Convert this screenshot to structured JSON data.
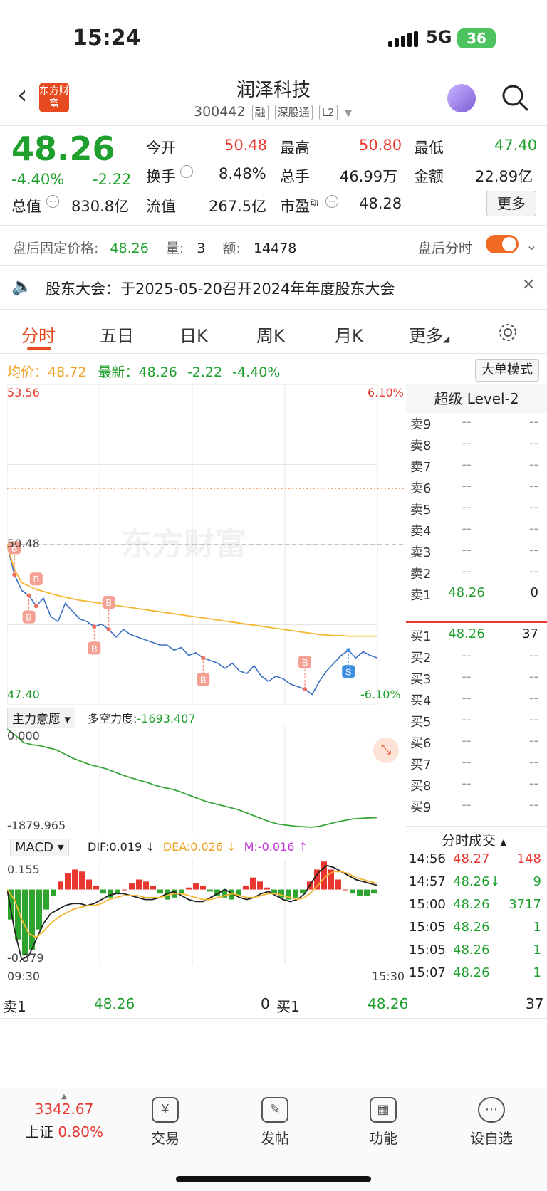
{
  "status_bar": {
    "time": "15:24",
    "network": "5G",
    "battery": "36"
  },
  "header": {
    "logo_text": "东方财富",
    "stock_name": "润泽科技",
    "stock_code": "300442",
    "tags": [
      "融",
      "深股通",
      "L2"
    ]
  },
  "quote": {
    "price": "48.26",
    "change_pct": "-4.40%",
    "change": "-2.22",
    "open_label": "今开",
    "open": "50.48",
    "high_label": "最高",
    "high": "50.80",
    "low_label": "最低",
    "low": "47.40",
    "turnover_label": "换手",
    "turnover": "8.48%",
    "volume_label": "总手",
    "volume": "46.99万",
    "amount_label": "金额",
    "amount": "22.89亿",
    "mktcap_label": "总值",
    "mktcap": "830.8亿",
    "float_label": "流值",
    "float": "267.5亿",
    "pe_label": "市盈",
    "pe_sup": "动",
    "pe": "48.28",
    "more_button": "更多"
  },
  "after_hours": {
    "price_label": "盘后固定价格:",
    "price": "48.26",
    "qty_label": "量:",
    "qty": "3",
    "amt_label": "额:",
    "amt": "14478",
    "toggle_label": "盘后分时"
  },
  "notice": {
    "text": "股东大会：于2025-05-20召开2024年年度股东大会"
  },
  "tabs": [
    "分时",
    "五日",
    "日K",
    "周K",
    "月K",
    "更多"
  ],
  "chart_info": {
    "avg_label": "均价：",
    "avg": "48.72",
    "latest_label": "最新：",
    "latest": "48.26",
    "latest_chg": "-2.22",
    "latest_pct": "-4.40%",
    "big_order_button": "大单模式"
  },
  "chart_data": {
    "type": "line",
    "title": "",
    "y_top_label": "53.56",
    "y_bottom_label": "47.40",
    "pct_top_label": "6.10%",
    "pct_bottom_label": "-6.10%",
    "prev_close_label": "50.48",
    "ylim": [
      47.4,
      53.56
    ],
    "prev_close": 50.48,
    "high_line": 51.56,
    "x_start_label": "09:30",
    "x_end_label": "15:30",
    "watermark": "东方财富",
    "series": [
      {
        "values": [
          50.48,
          49.9,
          49.6,
          49.5,
          49.3,
          49.45,
          49.1,
          49.0,
          49.35,
          49.2,
          49.05,
          49.0,
          48.9,
          48.95,
          48.85,
          48.7,
          48.85,
          48.75,
          48.7,
          48.65,
          48.6,
          48.55,
          48.55,
          48.45,
          48.5,
          48.35,
          48.4,
          48.3,
          48.25,
          48.2,
          48.1,
          48.2,
          48.05,
          48.0,
          48.15,
          47.95,
          47.85,
          47.95,
          47.9,
          47.8,
          47.75,
          47.7,
          47.6,
          47.85,
          48.05,
          48.2,
          48.35,
          48.45,
          48.3,
          48.42,
          48.35,
          48.3
        ]
      },
      {
        "values": [
          50.48,
          50.0,
          49.75,
          49.68,
          49.62,
          49.58,
          49.54,
          49.5,
          49.47,
          49.44,
          49.41,
          49.39,
          49.37,
          49.35,
          49.33,
          49.31,
          49.29,
          49.27,
          49.25,
          49.23,
          49.21,
          49.19,
          49.17,
          49.15,
          49.13,
          49.11,
          49.09,
          49.07,
          49.05,
          49.03,
          49.01,
          48.99,
          48.97,
          48.95,
          48.93,
          48.91,
          48.89,
          48.87,
          48.85,
          48.83,
          48.81,
          48.79,
          48.77,
          48.75,
          48.74,
          48.73,
          48.73,
          48.72,
          48.72,
          48.72,
          48.72,
          48.72
        ]
      }
    ],
    "markers": [
      "B",
      "B",
      "B",
      "B",
      "B",
      "B",
      "B",
      "S"
    ]
  },
  "force_panel": {
    "dropdown": "主力意愿",
    "label": "多空力度:",
    "value": "-1693.407",
    "top": "0.000",
    "bottom": "-1879.965",
    "values": [
      0,
      -120,
      -260,
      -300,
      -320,
      -360,
      -400,
      -480,
      -560,
      -620,
      -680,
      -720,
      -760,
      -820,
      -880,
      -930,
      -980,
      -1020,
      -1080,
      -1120,
      -1150,
      -1200,
      -1260,
      -1320,
      -1380,
      -1420,
      -1460,
      -1500,
      -1540,
      -1600,
      -1660,
      -1720,
      -1780,
      -1820,
      -1840,
      -1860,
      -1870,
      -1879,
      -1860,
      -1820,
      -1780,
      -1750,
      -1720,
      -1710,
      -1700,
      -1693
    ]
  },
  "macd_panel": {
    "dropdown": "MACD",
    "dif": "DIF:0.019",
    "dea": "DEA:0.026",
    "m": "M:-0.016",
    "top": "0.155",
    "bottom": "-0.379",
    "bars": [
      -0.15,
      -0.25,
      -0.33,
      -0.3,
      -0.2,
      -0.1,
      -0.03,
      0.04,
      0.08,
      0.1,
      0.09,
      0.05,
      0.02,
      -0.02,
      -0.04,
      -0.02,
      0.0,
      0.03,
      0.05,
      0.04,
      0.02,
      -0.02,
      -0.05,
      -0.04,
      -0.02,
      0.01,
      0.03,
      0.02,
      -0.01,
      -0.03,
      -0.04,
      -0.05,
      -0.03,
      0.02,
      0.06,
      0.04,
      0.01,
      -0.02,
      -0.04,
      -0.05,
      -0.04,
      -0.02,
      0.04,
      0.1,
      0.14,
      0.1,
      0.05,
      0.0,
      -0.02,
      -0.03,
      -0.03,
      -0.02
    ],
    "dif_line": [
      0,
      -0.2,
      -0.35,
      -0.33,
      -0.25,
      -0.17,
      -0.12,
      -0.1,
      -0.08,
      -0.07,
      -0.07,
      -0.08,
      -0.07,
      -0.05,
      -0.03,
      -0.02,
      -0.02,
      -0.03,
      -0.04,
      -0.05,
      -0.05,
      -0.04,
      -0.02,
      -0.01,
      -0.03,
      -0.05,
      -0.06,
      -0.06,
      -0.04,
      -0.02,
      0.0,
      -0.02,
      -0.04,
      -0.05,
      -0.04,
      -0.02,
      -0.01,
      -0.03,
      -0.05,
      -0.06,
      -0.05,
      -0.02,
      0.04,
      0.09,
      0.12,
      0.11,
      0.09,
      0.07,
      0.05,
      0.04,
      0.03,
      0.02
    ],
    "dea_line": [
      0,
      -0.05,
      -0.15,
      -0.22,
      -0.24,
      -0.21,
      -0.17,
      -0.14,
      -0.12,
      -0.1,
      -0.09,
      -0.08,
      -0.08,
      -0.07,
      -0.05,
      -0.04,
      -0.03,
      -0.03,
      -0.03,
      -0.04,
      -0.04,
      -0.04,
      -0.03,
      -0.02,
      -0.02,
      -0.03,
      -0.04,
      -0.05,
      -0.05,
      -0.04,
      -0.03,
      -0.02,
      -0.03,
      -0.04,
      -0.04,
      -0.03,
      -0.02,
      -0.02,
      -0.03,
      -0.04,
      -0.05,
      -0.04,
      -0.01,
      0.03,
      0.07,
      0.09,
      0.09,
      0.08,
      0.06,
      0.05,
      0.04,
      0.03
    ]
  },
  "order_book": {
    "title": "超级 Level-2",
    "sell": [
      {
        "label": "卖9",
        "price": "--",
        "vol": "--"
      },
      {
        "label": "卖8",
        "price": "--",
        "vol": "--"
      },
      {
        "label": "卖7",
        "price": "--",
        "vol": "--"
      },
      {
        "label": "卖6",
        "price": "--",
        "vol": "--"
      },
      {
        "label": "卖5",
        "price": "--",
        "vol": "--"
      },
      {
        "label": "卖4",
        "price": "--",
        "vol": "--"
      },
      {
        "label": "卖3",
        "price": "--",
        "vol": "--"
      },
      {
        "label": "卖2",
        "price": "--",
        "vol": "--"
      },
      {
        "label": "卖1",
        "price": "48.26",
        "vol": "0"
      }
    ],
    "buy": [
      {
        "label": "买1",
        "price": "48.26",
        "vol": "37"
      },
      {
        "label": "买2",
        "price": "--",
        "vol": "--"
      },
      {
        "label": "买3",
        "price": "--",
        "vol": "--"
      },
      {
        "label": "买4",
        "price": "--",
        "vol": "--"
      },
      {
        "label": "买5",
        "price": "--",
        "vol": "--"
      },
      {
        "label": "买6",
        "price": "--",
        "vol": "--"
      },
      {
        "label": "买7",
        "price": "--",
        "vol": "--"
      },
      {
        "label": "买8",
        "price": "--",
        "vol": "--"
      },
      {
        "label": "买9",
        "price": "--",
        "vol": "--"
      }
    ]
  },
  "ticks": {
    "title": "分时成交",
    "rows": [
      {
        "time": "14:56",
        "price": "48.27",
        "vol": "148"
      },
      {
        "time": "14:57",
        "price": "48.26↓",
        "vol": "9"
      },
      {
        "time": "15:00",
        "price": "48.26",
        "vol": "3717"
      },
      {
        "time": "15:05",
        "price": "48.26",
        "vol": "1"
      },
      {
        "time": "15:05",
        "price": "48.26",
        "vol": "1"
      },
      {
        "time": "15:07",
        "price": "48.26",
        "vol": "1"
      }
    ]
  },
  "bottom_quote": {
    "sell_label": "卖1",
    "sell_price": "48.26",
    "sell_vol": "0",
    "buy_label": "买1",
    "buy_price": "48.26",
    "buy_vol": "37"
  },
  "bottom_bar": {
    "index_value": "3342.67",
    "index_name": "上证",
    "index_pct": "0.80%",
    "items": [
      "交易",
      "发帖",
      "功能",
      "设自选"
    ]
  }
}
